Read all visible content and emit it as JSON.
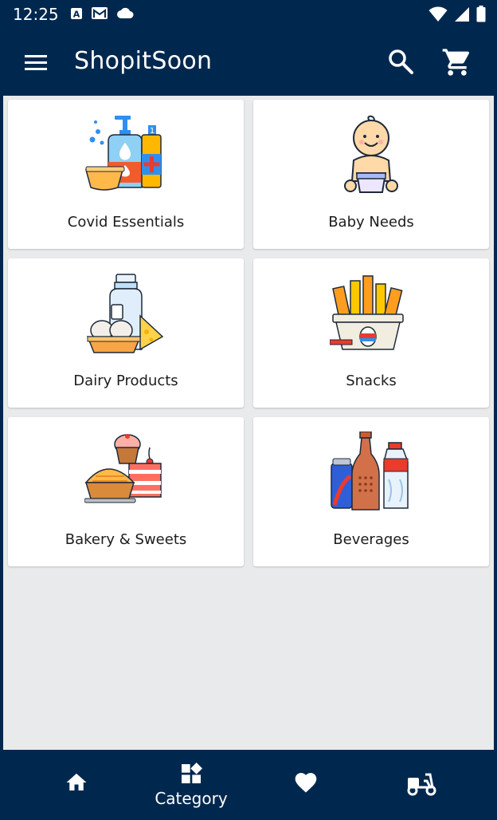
{
  "status_bar": {
    "time": "12:25",
    "left_icons": [
      "a-icon",
      "gmail-icon",
      "cloud-icon"
    ],
    "right_icons": [
      "wifi-icon",
      "signal-icon",
      "battery-icon"
    ]
  },
  "app_bar": {
    "title": "ShopitSoon",
    "menu_icon": "menu-icon",
    "search_icon": "search-icon",
    "cart_icon": "cart-icon"
  },
  "categories": [
    {
      "label": "Covid Essentials",
      "icon": "sanitizer-icon"
    },
    {
      "label": "Baby Needs",
      "icon": "baby-icon"
    },
    {
      "label": "Dairy Products",
      "icon": "dairy-icon"
    },
    {
      "label": "Snacks",
      "icon": "snacks-icon"
    },
    {
      "label": "Bakery & Sweets",
      "icon": "bakery-icon"
    },
    {
      "label": "Beverages",
      "icon": "beverages-icon"
    }
  ],
  "bottom_nav": {
    "items": [
      {
        "icon": "home-icon",
        "label": ""
      },
      {
        "icon": "category-icon",
        "label": "Category"
      },
      {
        "icon": "heart-icon",
        "label": ""
      },
      {
        "icon": "delivery-scooter-icon",
        "label": ""
      }
    ],
    "active_index": 1
  },
  "colors": {
    "primary": "#00284f",
    "background": "#e9eaec",
    "card": "#ffffff",
    "text": "#1d1d1d"
  }
}
